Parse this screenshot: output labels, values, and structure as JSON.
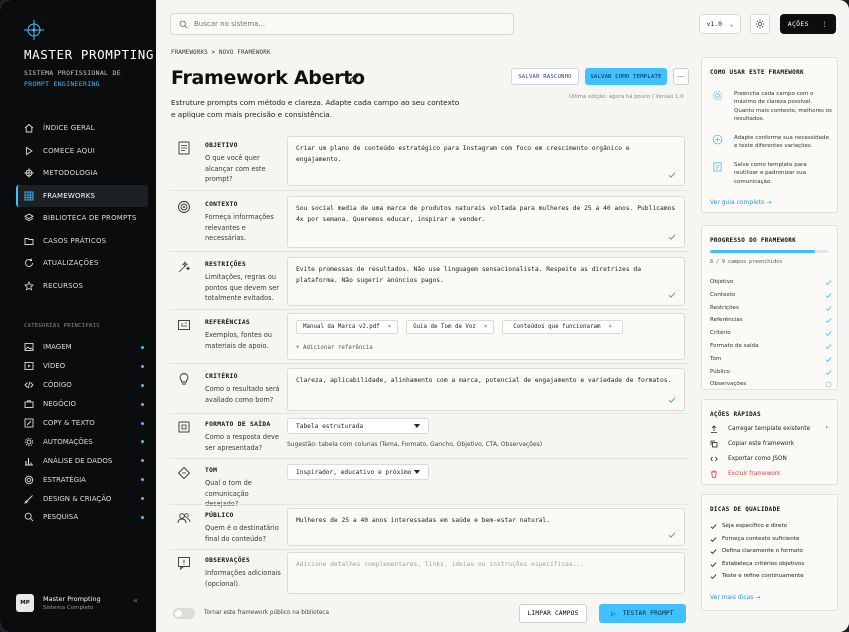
{
  "sidebar": {
    "brand": "MASTER PROMPTING",
    "tagline1": "SISTEMA PROFISSIONAL DE",
    "tagline2": "PROMPT ENGINEERING",
    "nav": [
      {
        "label": "ÍNDICE GERAL",
        "icon": "home-icon"
      },
      {
        "label": "COMECE AQUI",
        "icon": "play-icon"
      },
      {
        "label": "METODOLOGIA",
        "icon": "crosshair-icon"
      },
      {
        "label": "FRAMEWORKS",
        "icon": "grid-icon",
        "active": true
      },
      {
        "label": "BIBLIOTECA DE PROMPTS",
        "icon": "layers-icon"
      },
      {
        "label": "CASOS PRÁTICOS",
        "icon": "folder-icon"
      },
      {
        "label": "ATUALIZAÇÕES",
        "icon": "refresh-icon"
      },
      {
        "label": "RECURSOS",
        "icon": "star-icon"
      }
    ],
    "categories_heading": "CATEGORIAS PRINCIPAIS",
    "categories": [
      {
        "label": "IMAGEM",
        "icon": "image-icon"
      },
      {
        "label": "VÍDEO",
        "icon": "video-icon"
      },
      {
        "label": "CÓDIGO",
        "icon": "code-icon"
      },
      {
        "label": "NEGÓCIO",
        "icon": "briefcase-icon"
      },
      {
        "label": "COPY & TEXTO",
        "icon": "pen-icon"
      },
      {
        "label": "AUTOMAÇÕES",
        "icon": "gear-icon"
      },
      {
        "label": "ANÁLISE DE DADOS",
        "icon": "bar-chart-icon"
      },
      {
        "label": "ESTRATÉGIA",
        "icon": "target-icon"
      },
      {
        "label": "DESIGN & CRIAÇÃO",
        "icon": "brush-icon"
      },
      {
        "label": "PESQUISA",
        "icon": "search-icon"
      }
    ],
    "user": {
      "initials": "MP",
      "name": "Master Prompting",
      "subtitle": "Sistema Completo"
    }
  },
  "topbar": {
    "search_placeholder": "Buscar no sistema...",
    "version": "v1.0",
    "actions_label": "AÇÕES"
  },
  "page": {
    "breadcrumb": "FRAMEWORKS  >  NOVO FRAMEWORK",
    "title": "Framework Aberto",
    "description": "Estruture prompts com método e clareza. Adapte cada campo ao seu contexto e aplique com mais precisão e consistência.",
    "save_draft": "SALVAR RASCUNHO",
    "save_template": "SALVAR COMO TEMPLATE",
    "more": "···",
    "last_edit": "Última edição: agora há pouco   |   Versão 1.0"
  },
  "fields": {
    "objetivo": {
      "name": "OBJETIVO",
      "question": "O que você quer alcançar com este prompt?",
      "value": "Criar um plano de conteúdo estratégico para Instagram com foco em crescimento orgânico e engajamento."
    },
    "contexto": {
      "name": "CONTEXTO",
      "question": "Forneça informações relevantes e necessárias.",
      "value": "Sou social media de uma marca de produtos naturais voltada para mulheres de 25 a 40 anos. Publicamos 4x por semana. Queremos educar, inspirar e vender."
    },
    "restricoes": {
      "name": "RESTRIÇÕES",
      "question": "Limitações, regras ou pontos que devem ser totalmente evitados.",
      "value": "Evite promessas de resultados. Não use linguagem sensacionalista. Respeite as diretrizes da plataforma. Não sugerir anúncios pagos."
    },
    "referencias": {
      "name": "REFERÊNCIAS",
      "question": "Exemplos, fontes ou materiais de apoio.",
      "chips": [
        "Manual da Marca v2.pdf",
        "Guia de Tom de Voz",
        "Conteúdos que funcionaram"
      ],
      "add": "+ Adicionar referência"
    },
    "criterio": {
      "name": "CRITÉRIO",
      "question": "Como o resultado será avaliado como bom?",
      "value": "Clareza, aplicabilidade, alinhamento com a marca, potencial de engajamento e variedade de formatos."
    },
    "formato": {
      "name": "FORMATO DE SAÍDA",
      "question": "Como a resposta deve ser apresentada?",
      "value": "Tabela estruturada",
      "suggestion": "Sugestão: tabela com colunas (Tema, Formato, Gancho, Objetivo, CTA, Observações)"
    },
    "tom": {
      "name": "TOM",
      "question": "Qual o tom de comunicação desejado?",
      "value": "Inspirador, educativo e próximo"
    },
    "publico": {
      "name": "PÚBLICO",
      "question": "Quem é o destinatário final do conteúdo?",
      "value": "Mulheres de 25 a 40 anos interessadas em saúde e bem-estar natural."
    },
    "observacoes": {
      "name": "OBSERVAÇÕES",
      "question": "Informações adicionais (opcional).",
      "placeholder": "Adicione detalhes complementares, links, ideias ou instruções específicas..."
    }
  },
  "footer": {
    "toggle_label": "Tornar este framework público na biblioteca",
    "clear": "LIMPAR CAMPOS",
    "test": "TESTAR PROMPT"
  },
  "howto": {
    "heading": "COMO USAR ESTE FRAMEWORK",
    "tips": [
      "Preencha cada campo com o máximo de clareza possível. Quanto mais contexto, melhores os resultados.",
      "Adapte conforme sua necessidade e teste diferentes variações.",
      "Salve como template para reutilizar e padronizar sua comunicação."
    ],
    "link": "Ver guia completo  →"
  },
  "progress": {
    "heading": "PROGRESSO DO FRAMEWORK",
    "fraction": 0.89,
    "count": "8 / 9 campos preenchidos",
    "items": [
      {
        "label": "Objetivo",
        "done": true
      },
      {
        "label": "Contexto",
        "done": true
      },
      {
        "label": "Restrições",
        "done": true
      },
      {
        "label": "Referências",
        "done": true
      },
      {
        "label": "Critério",
        "done": true
      },
      {
        "label": "Formato de saída",
        "done": true
      },
      {
        "label": "Tom",
        "done": true
      },
      {
        "label": "Público",
        "done": true
      },
      {
        "label": "Observações",
        "done": false
      }
    ]
  },
  "quick": {
    "heading": "AÇÕES RÁPIDAS",
    "items": [
      "Carregar template existente",
      "Copiar este framework",
      "Exportar como JSON",
      "Excluir framework"
    ]
  },
  "tips": {
    "heading": "DICAS DE QUALIDADE",
    "items": [
      "Seja específico e direto",
      "Forneça contexto suficiente",
      "Defina claramente o formato",
      "Estabeleça critérios objetivos",
      "Teste e refine continuamente"
    ],
    "link": "Ver mais dicas  →"
  },
  "colors": {
    "accent": "#3fc1ff",
    "danger": "#e0413a",
    "success": "#3ab36e"
  }
}
